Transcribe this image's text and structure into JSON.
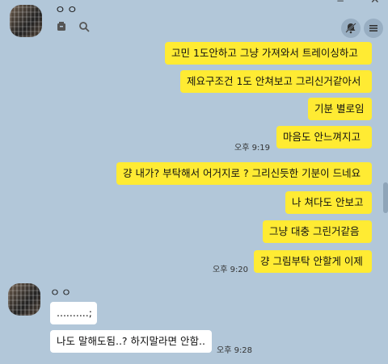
{
  "header": {
    "name": "ㅇㅇ",
    "minimize": "−",
    "close": "✕"
  },
  "messages": {
    "m1": "고민 1도안하고 그냥 가져와서 트레이싱하고",
    "m2": "제요구조건 1도 안쳐보고 그리신거같아서",
    "m3": "기분 별로임",
    "m4": "마음도 안느껴지고",
    "t1": "오후 9:19",
    "m5": "걍 내가? 부탁해서 어거지로 ? 그리신듯한 기분이 드네요",
    "m6": "나 쳐다도 안보고",
    "m7": "그냥 대충 그린거같음",
    "m8": "걍 그림부탁 안할게 이제",
    "t2": "오후 9:20"
  },
  "peer": {
    "name": "ㅇㅇ",
    "r1": "..........;",
    "r2": "나도 말해도됨..? 하지말라면 안함..",
    "t3": "오후 9:28"
  }
}
